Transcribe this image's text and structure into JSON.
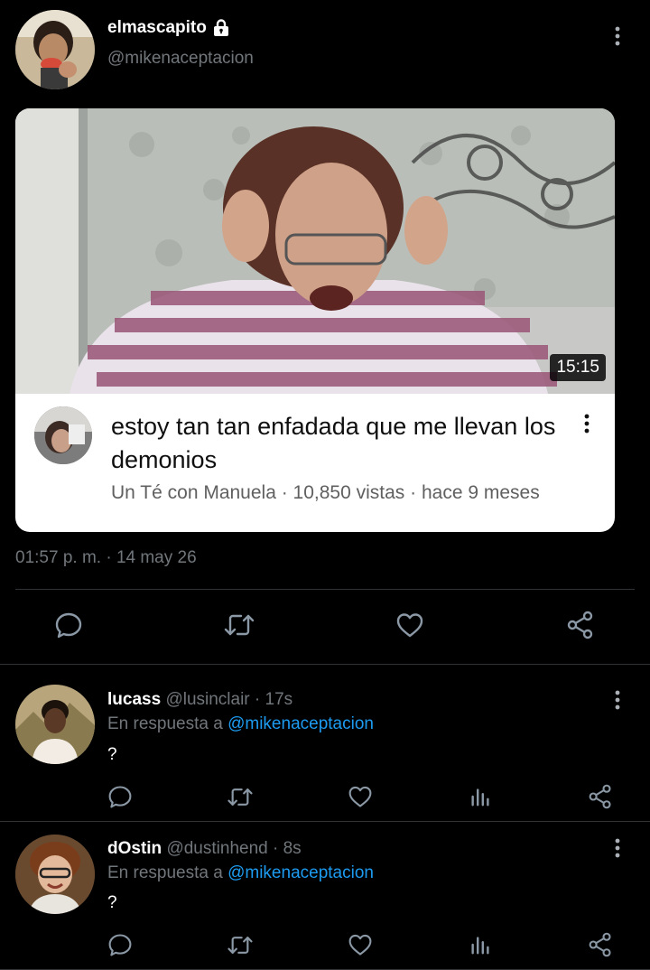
{
  "tweet": {
    "author": {
      "display_name": "elmascapito",
      "handle": "@mikenaceptacion",
      "protected_icon": "lock-icon"
    },
    "media": {
      "duration": "15:15",
      "video_title": "estoy tan tan enfadada que me llevan los demonios",
      "channel": "Un Té con Manuela",
      "views": "10,850 vistas",
      "age": "hace 9 meses",
      "meta_line": "Un Té con Manuela · 10,850 vistas · hace 9 meses"
    },
    "timestamp": "01:57 p. m. · 14 may 26",
    "actions": [
      "reply-icon",
      "retweet-icon",
      "like-icon",
      "share-icon"
    ]
  },
  "replies": [
    {
      "display_name": "lucass",
      "handle": "@lusinclair",
      "time": "· 17s",
      "reply_label": "En respuesta a",
      "mention": "@mikenaceptacion",
      "text": "?"
    },
    {
      "display_name": "dOstin",
      "handle": "@dustinhend",
      "time": "· 8s",
      "reply_label": "En respuesta a",
      "mention": "@mikenaceptacion",
      "text": "?"
    }
  ],
  "colors": {
    "background": "#000000",
    "text": "#e7e9ea",
    "muted": "#71767b",
    "accent": "#1d9bf0",
    "divider": "#2f3336"
  }
}
